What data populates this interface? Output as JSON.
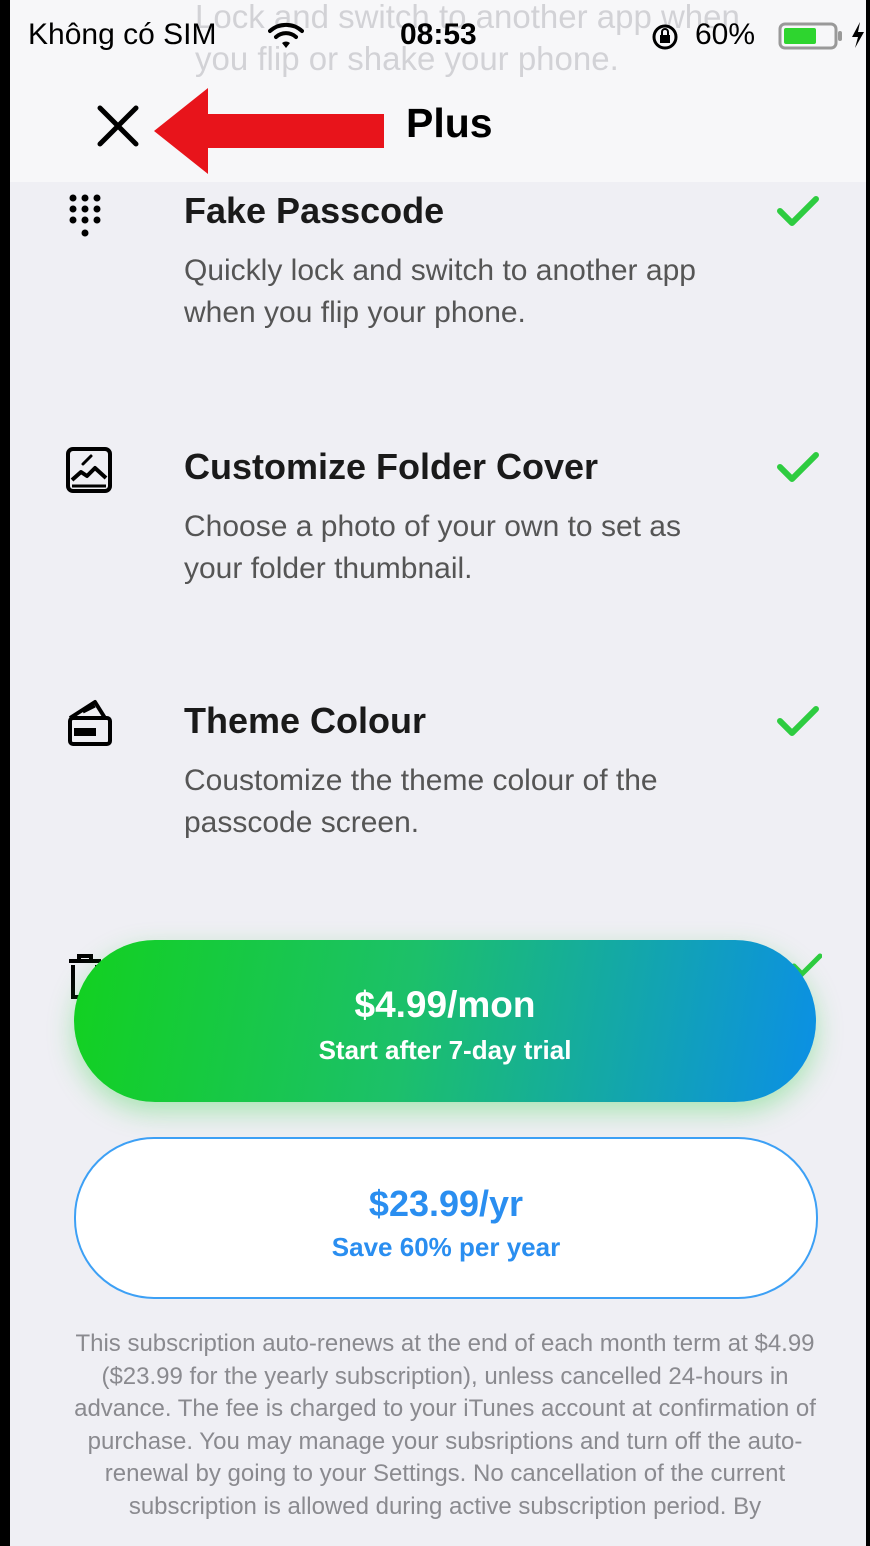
{
  "status_bar": {
    "carrier": "Không có SIM",
    "time": "08:53",
    "battery": "60%"
  },
  "background_text": "Lock and switch to another app when you flip or shake your phone.",
  "header": {
    "title": "Plus",
    "close_icon": "close-icon",
    "annotation": "red-arrow-icon"
  },
  "features": [
    {
      "icon": "keypad-icon",
      "title": "Fake Passcode",
      "description": "Quickly lock and switch to another app when you flip your phone."
    },
    {
      "icon": "image-chart-icon",
      "title": "Customize Folder Cover",
      "description": "Choose a photo of your own to set as your folder thumbnail."
    },
    {
      "icon": "palette-icon",
      "title": "Theme Colour",
      "description": "Coustomize the theme colour of the passcode screen."
    }
  ],
  "plans": {
    "monthly": {
      "price": "$4.99/mon",
      "note": "Start after 7-day trial"
    },
    "yearly": {
      "price": "$23.99/yr",
      "note": "Save 60% per year"
    }
  },
  "legal": "This subscription auto-renews at the end of each month term at $4.99 ($23.99 for the yearly subscription), unless cancelled 24-hours in advance. The fee is charged to your iTunes account at confirmation of purchase. You may manage your subsriptions and turn off the auto-renewal by going to your Settings. No cancellation of the current subscription is allowed during active subscription period. By",
  "colors": {
    "accent_green": "#2ecc40",
    "accent_blue": "#2a8ef0",
    "arrow_red": "#e8141b"
  }
}
